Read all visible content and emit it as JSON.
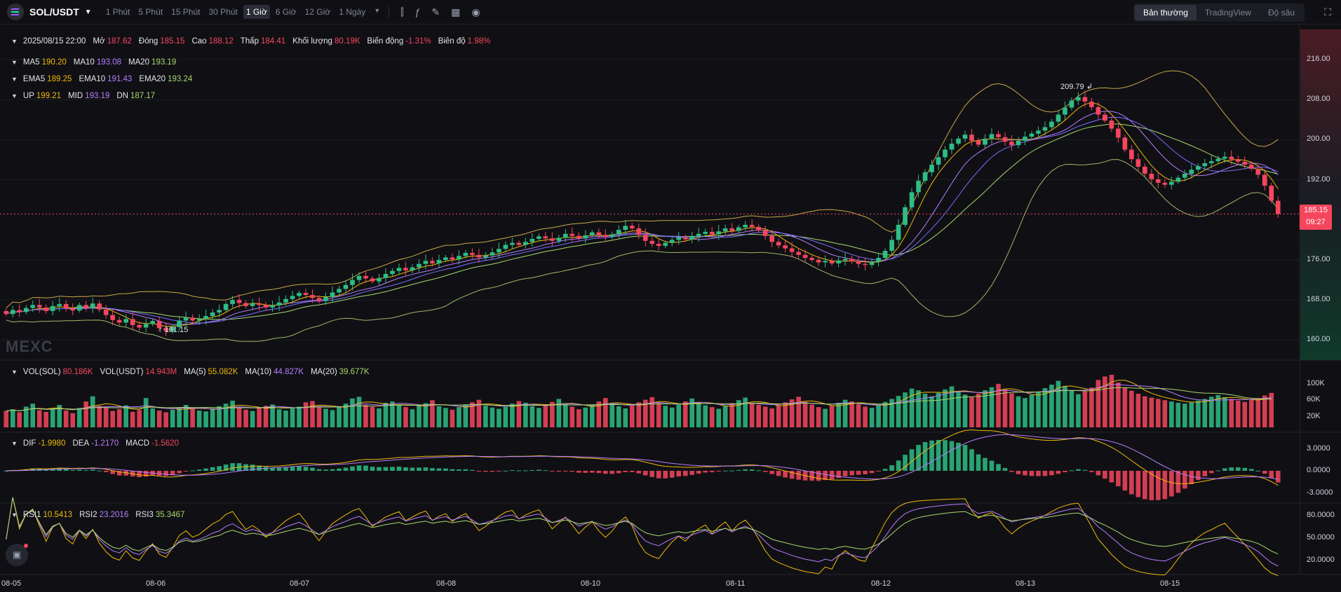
{
  "header": {
    "pair": "SOL/USDT",
    "intervals": [
      "1 Phút",
      "5 Phút",
      "15 Phút",
      "30 Phút",
      "1 Giờ",
      "6 Giờ",
      "12 Giờ",
      "1 Ngày"
    ],
    "active_interval": "1 Giờ",
    "tools": [
      "candle-type-icon",
      "indicator-icon",
      "draw-icon",
      "layout-icon",
      "screenshot-icon"
    ],
    "modes": [
      "Bản thường",
      "TradingView",
      "Độ sâu"
    ],
    "active_mode": "Bản thường"
  },
  "ohlc": {
    "date": "2025/08/15 22:00",
    "open_label": "Mở",
    "open": "187.62",
    "close_label": "Đóng",
    "close": "185.15",
    "high_label": "Cao",
    "high": "188.12",
    "low_label": "Thấp",
    "low": "184.41",
    "vol_label": "Khối lượng",
    "vol": "80.19K",
    "change_label": "Biến động",
    "change": "-1.31%",
    "amp_label": "Biên độ",
    "amp": "1.98%"
  },
  "ma": {
    "ma5_label": "MA5",
    "ma5": "190.20",
    "ma10_label": "MA10",
    "ma10": "193.08",
    "ma20_label": "MA20",
    "ma20": "193.19"
  },
  "ema": {
    "ema5_label": "EMA5",
    "ema5": "189.25",
    "ema10_label": "EMA10",
    "ema10": "191.43",
    "ema20_label": "EMA20",
    "ema20": "193.24"
  },
  "boll": {
    "up_label": "UP",
    "up": "199.21",
    "mid_label": "MID",
    "mid": "193.19",
    "dn_label": "DN",
    "dn": "187.17"
  },
  "volume": {
    "sol_label": "VOL(SOL)",
    "sol": "80.186K",
    "usdt_label": "VOL(USDT)",
    "usdt": "14.943M",
    "ma5_label": "MA(5)",
    "ma5": "55.082K",
    "ma10_label": "MA(10)",
    "ma10": "44.827K",
    "ma20_label": "MA(20)",
    "ma20": "39.677K"
  },
  "macd": {
    "dif_label": "DIF",
    "dif": "-1.9980",
    "dea_label": "DEA",
    "dea": "-1.2170",
    "macd_label": "MACD",
    "macd": "-1.5620"
  },
  "rsi": {
    "rsi1_label": "RSI1",
    "rsi1": "10.5413",
    "rsi2_label": "RSI2",
    "rsi2": "23.2016",
    "rsi3_label": "RSI3",
    "rsi3": "35.3467"
  },
  "price_axis": [
    "216.00",
    "208.00",
    "200.00",
    "192.00",
    "176.00",
    "168.00",
    "160.00"
  ],
  "volume_axis": [
    "100K",
    "60K",
    "20K"
  ],
  "macd_axis": [
    "3.0000",
    "0.0000",
    "-3.0000"
  ],
  "rsi_axis": [
    "80.0000",
    "50.0000",
    "20.0000"
  ],
  "last_price": {
    "price": "185.15",
    "countdown": "09:27"
  },
  "high_marker": "209.79",
  "low_marker": "161.15",
  "watermark": "MEXC",
  "date_labels": [
    "08-05",
    "08-06",
    "08-07",
    "08-08",
    "08-10",
    "08-11",
    "08-12",
    "08-13",
    "08-15"
  ],
  "colors": {
    "up": "#2ebd85",
    "down": "#f6465d",
    "ma5": "#f0b90b",
    "ma10": "#b67dff",
    "ma20": "#a9d86e"
  },
  "chart_data": {
    "type": "candlestick",
    "price_range": [
      156,
      222
    ],
    "closes": [
      165.2,
      166.0,
      165.6,
      166.4,
      167.0,
      166.5,
      165.8,
      166.8,
      167.2,
      166.3,
      165.9,
      167.0,
      166.4,
      167.3,
      166.1,
      165.0,
      164.0,
      163.5,
      164.2,
      163.0,
      162.5,
      163.2,
      163.8,
      162.4,
      161.8,
      162.6,
      163.9,
      164.5,
      163.9,
      164.2,
      164.8,
      165.5,
      166.0,
      167.2,
      168.0,
      167.4,
      166.8,
      167.3,
      167.0,
      166.5,
      166.9,
      167.5,
      168.2,
      168.8,
      169.4,
      169.0,
      168.4,
      167.8,
      168.6,
      169.5,
      170.2,
      171.0,
      172.0,
      172.8,
      172.3,
      171.7,
      172.4,
      173.2,
      173.8,
      174.4,
      173.9,
      174.5,
      175.2,
      175.8,
      175.3,
      176.0,
      176.5,
      176.1,
      176.8,
      177.4,
      177.0,
      176.5,
      176.9,
      177.5,
      178.2,
      179.0,
      179.4,
      179.0,
      179.6,
      180.2,
      180.7,
      180.3,
      179.8,
      180.4,
      181.2,
      180.8,
      180.3,
      180.9,
      181.5,
      181.0,
      180.6,
      181.1,
      182.0,
      182.8,
      182.3,
      181.0,
      179.8,
      179.2,
      178.8,
      179.4,
      180.0,
      180.5,
      180.1,
      180.7,
      181.2,
      181.6,
      181.1,
      181.7,
      182.3,
      181.8,
      182.5,
      183.0,
      182.6,
      181.9,
      180.8,
      179.6,
      178.9,
      178.3,
      177.6,
      177.0,
      176.4,
      176.0,
      175.5,
      175.8,
      175.3,
      175.9,
      176.2,
      175.7,
      175.2,
      175.0,
      175.6,
      176.4,
      177.8,
      180.0,
      183.0,
      186.5,
      189.5,
      191.8,
      193.5,
      195.0,
      196.5,
      198.0,
      199.2,
      200.2,
      201.0,
      199.8,
      199.0,
      200.2,
      201.1,
      200.5,
      199.6,
      198.9,
      199.8,
      200.6,
      201.2,
      201.8,
      202.5,
      203.6,
      205.0,
      206.4,
      207.8,
      208.5,
      207.6,
      206.5,
      205.0,
      203.8,
      202.2,
      200.4,
      198.0,
      196.1,
      194.6,
      193.2,
      192.1,
      191.4,
      191.0,
      191.6,
      192.4,
      193.2,
      194.0,
      194.7,
      195.3,
      195.7,
      196.2,
      196.6,
      196.1,
      195.6,
      195.0,
      194.2,
      193.0,
      190.8,
      187.8,
      185.15
    ],
    "volumes": [
      38,
      42,
      35,
      48,
      55,
      40,
      36,
      44,
      52,
      39,
      33,
      45,
      60,
      72,
      50,
      47,
      38,
      42,
      51,
      36,
      40,
      68,
      44,
      39,
      35,
      41,
      46,
      52,
      43,
      39,
      37,
      44,
      49,
      55,
      62,
      47,
      41,
      38,
      45,
      50,
      53,
      42,
      39,
      44,
      48,
      58,
      61,
      46,
      43,
      40,
      49,
      55,
      67,
      71,
      52,
      48,
      44,
      57,
      60,
      53,
      47,
      42,
      50,
      56,
      63,
      49,
      45,
      41,
      47,
      52,
      58,
      64,
      50,
      46,
      43,
      48,
      55,
      61,
      57,
      49,
      45,
      52,
      59,
      66,
      54,
      48,
      42,
      46,
      53,
      60,
      68,
      55,
      49,
      44,
      51,
      58,
      64,
      70,
      56,
      50,
      46,
      53,
      60,
      67,
      58,
      51,
      47,
      43,
      49,
      56,
      63,
      69,
      57,
      52,
      48,
      44,
      51,
      58,
      65,
      71,
      59,
      53,
      47,
      43,
      50,
      57,
      64,
      60,
      54,
      48,
      45,
      52,
      59,
      66,
      73,
      81,
      90,
      86,
      78,
      72,
      80,
      88,
      95,
      84,
      76,
      70,
      78,
      86,
      93,
      101,
      88,
      79,
      72,
      68,
      75,
      83,
      91,
      99,
      108,
      96,
      85,
      77,
      84,
      92,
      110,
      118,
      122,
      104,
      92,
      85,
      78,
      72,
      69,
      66,
      63,
      60,
      57,
      55,
      58,
      62,
      66,
      71,
      75,
      70,
      66,
      62,
      59,
      63,
      68,
      74,
      80
    ]
  }
}
